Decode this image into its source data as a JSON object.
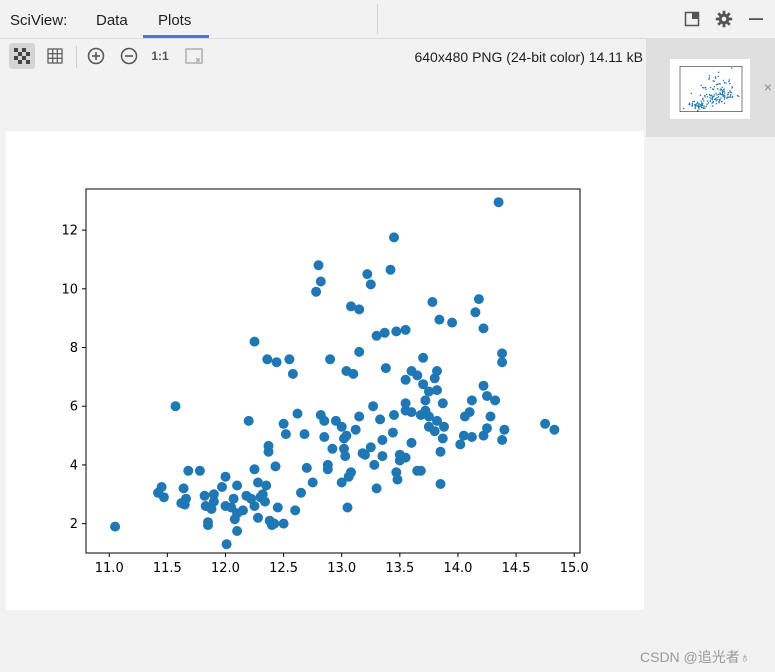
{
  "window": {
    "app_title": "SciView:",
    "tabs": [
      {
        "label": "Data"
      },
      {
        "label": "Plots"
      }
    ],
    "active_tab": "Plots"
  },
  "top_icons": [
    "dock-layout-icon",
    "gear-icon",
    "minimize-icon"
  ],
  "toolbar": {
    "buttons": [
      "checker-background-icon",
      "grid-icon",
      "zoom-in-icon",
      "zoom-out-icon",
      "actual-size",
      "fit-window-icon"
    ],
    "actual_size_label": "1:1",
    "image_info": "640x480 PNG (24-bit color) 14.11 kB"
  },
  "thumbnails": {
    "close_glyph": "×"
  },
  "watermark": "CSDN @追光者♁",
  "colors": {
    "accent": "#3d7dd6",
    "marker": "#1f77b4",
    "panel_bg": "#f2f2f2"
  },
  "chart_data": {
    "type": "scatter",
    "title": "",
    "xlabel": "",
    "ylabel": "",
    "xlim": [
      10.8,
      15.05
    ],
    "ylim": [
      1.0,
      13.4
    ],
    "xticks": [
      11.0,
      11.5,
      12.0,
      12.5,
      13.0,
      13.5,
      14.0,
      14.5,
      15.0
    ],
    "yticks": [
      2,
      4,
      6,
      8,
      10,
      12
    ],
    "grid": false,
    "series": [
      {
        "points": [
          [
            11.05,
            1.9
          ],
          [
            11.42,
            3.05
          ],
          [
            11.45,
            3.25
          ],
          [
            11.47,
            2.9
          ],
          [
            11.57,
            6.0
          ],
          [
            11.62,
            2.7
          ],
          [
            11.64,
            3.2
          ],
          [
            11.65,
            2.65
          ],
          [
            11.66,
            2.85
          ],
          [
            11.68,
            3.8
          ],
          [
            11.78,
            3.8
          ],
          [
            11.82,
            2.95
          ],
          [
            11.83,
            2.6
          ],
          [
            11.85,
            2.05
          ],
          [
            11.85,
            1.95
          ],
          [
            11.88,
            2.5
          ],
          [
            11.9,
            2.75
          ],
          [
            11.9,
            3.0
          ],
          [
            11.97,
            3.25
          ],
          [
            12.0,
            3.6
          ],
          [
            12.0,
            2.6
          ],
          [
            12.01,
            1.3
          ],
          [
            12.05,
            2.55
          ],
          [
            12.07,
            2.85
          ],
          [
            12.08,
            2.15
          ],
          [
            12.1,
            1.75
          ],
          [
            12.1,
            3.3
          ],
          [
            12.1,
            2.35
          ],
          [
            12.15,
            2.45
          ],
          [
            12.18,
            2.95
          ],
          [
            12.2,
            5.5
          ],
          [
            12.22,
            2.85
          ],
          [
            12.25,
            3.85
          ],
          [
            12.25,
            2.6
          ],
          [
            12.25,
            8.2
          ],
          [
            12.28,
            3.4
          ],
          [
            12.28,
            2.2
          ],
          [
            12.3,
            2.9
          ],
          [
            12.32,
            3.0
          ],
          [
            12.34,
            2.75
          ],
          [
            12.35,
            3.3
          ],
          [
            12.36,
            7.6
          ],
          [
            12.37,
            4.65
          ],
          [
            12.37,
            4.45
          ],
          [
            12.38,
            2.1
          ],
          [
            12.4,
            1.95
          ],
          [
            12.42,
            2.0
          ],
          [
            12.43,
            3.95
          ],
          [
            12.44,
            7.5
          ],
          [
            12.45,
            2.55
          ],
          [
            12.5,
            5.4
          ],
          [
            12.5,
            2.0
          ],
          [
            12.52,
            5.05
          ],
          [
            12.55,
            7.6
          ],
          [
            12.58,
            7.1
          ],
          [
            12.6,
            2.45
          ],
          [
            12.62,
            5.75
          ],
          [
            12.65,
            3.05
          ],
          [
            12.68,
            5.05
          ],
          [
            12.7,
            3.9
          ],
          [
            12.75,
            3.4
          ],
          [
            12.78,
            9.9
          ],
          [
            12.8,
            10.8
          ],
          [
            12.82,
            5.7
          ],
          [
            12.82,
            10.25
          ],
          [
            12.85,
            4.95
          ],
          [
            12.85,
            5.5
          ],
          [
            12.88,
            4.0
          ],
          [
            12.88,
            3.85
          ],
          [
            12.9,
            7.6
          ],
          [
            12.92,
            4.55
          ],
          [
            12.95,
            5.5
          ],
          [
            13.0,
            5.3
          ],
          [
            13.0,
            3.4
          ],
          [
            13.02,
            4.9
          ],
          [
            13.02,
            4.55
          ],
          [
            13.03,
            4.3
          ],
          [
            13.04,
            5.0
          ],
          [
            13.04,
            7.2
          ],
          [
            13.05,
            2.55
          ],
          [
            13.06,
            3.6
          ],
          [
            13.08,
            3.75
          ],
          [
            13.08,
            9.4
          ],
          [
            13.1,
            7.1
          ],
          [
            13.12,
            5.2
          ],
          [
            13.15,
            9.3
          ],
          [
            13.15,
            5.65
          ],
          [
            13.15,
            7.85
          ],
          [
            13.18,
            4.4
          ],
          [
            13.2,
            4.35
          ],
          [
            13.22,
            10.5
          ],
          [
            13.25,
            10.15
          ],
          [
            13.25,
            4.6
          ],
          [
            13.27,
            6.0
          ],
          [
            13.28,
            4.0
          ],
          [
            13.3,
            8.4
          ],
          [
            13.3,
            3.2
          ],
          [
            13.33,
            5.55
          ],
          [
            13.35,
            4.3
          ],
          [
            13.35,
            4.85
          ],
          [
            13.37,
            8.5
          ],
          [
            13.38,
            7.3
          ],
          [
            13.42,
            10.65
          ],
          [
            13.44,
            5.1
          ],
          [
            13.45,
            11.75
          ],
          [
            13.45,
            5.7
          ],
          [
            13.47,
            3.75
          ],
          [
            13.47,
            8.55
          ],
          [
            13.48,
            3.5
          ],
          [
            13.5,
            4.15
          ],
          [
            13.5,
            4.35
          ],
          [
            13.55,
            8.6
          ],
          [
            13.55,
            6.1
          ],
          [
            13.55,
            5.85
          ],
          [
            13.55,
            6.9
          ],
          [
            13.55,
            4.25
          ],
          [
            13.6,
            4.75
          ],
          [
            13.6,
            5.8
          ],
          [
            13.6,
            7.2
          ],
          [
            13.65,
            3.8
          ],
          [
            13.65,
            7.05
          ],
          [
            13.68,
            3.8
          ],
          [
            13.68,
            5.7
          ],
          [
            13.7,
            7.65
          ],
          [
            13.7,
            6.75
          ],
          [
            13.72,
            6.2
          ],
          [
            13.72,
            5.85
          ],
          [
            13.75,
            6.5
          ],
          [
            13.75,
            5.3
          ],
          [
            13.75,
            5.65
          ],
          [
            13.78,
            9.55
          ],
          [
            13.8,
            5.15
          ],
          [
            13.8,
            6.95
          ],
          [
            13.82,
            6.55
          ],
          [
            13.82,
            5.5
          ],
          [
            13.82,
            7.2
          ],
          [
            13.84,
            8.95
          ],
          [
            13.85,
            4.45
          ],
          [
            13.85,
            3.35
          ],
          [
            13.87,
            6.1
          ],
          [
            13.87,
            4.9
          ],
          [
            13.88,
            5.3
          ],
          [
            13.95,
            8.85
          ],
          [
            14.02,
            4.7
          ],
          [
            14.05,
            5.0
          ],
          [
            14.06,
            5.65
          ],
          [
            14.1,
            5.8
          ],
          [
            14.12,
            6.2
          ],
          [
            14.12,
            4.95
          ],
          [
            14.15,
            9.2
          ],
          [
            14.18,
            9.65
          ],
          [
            14.22,
            5.0
          ],
          [
            14.22,
            8.65
          ],
          [
            14.22,
            6.7
          ],
          [
            14.25,
            5.25
          ],
          [
            14.25,
            6.35
          ],
          [
            14.28,
            5.65
          ],
          [
            14.32,
            6.2
          ],
          [
            14.35,
            12.95
          ],
          [
            14.38,
            4.85
          ],
          [
            14.38,
            7.8
          ],
          [
            14.38,
            7.5
          ],
          [
            14.4,
            5.2
          ],
          [
            14.75,
            5.4
          ],
          [
            14.83,
            5.2
          ]
        ]
      }
    ]
  }
}
